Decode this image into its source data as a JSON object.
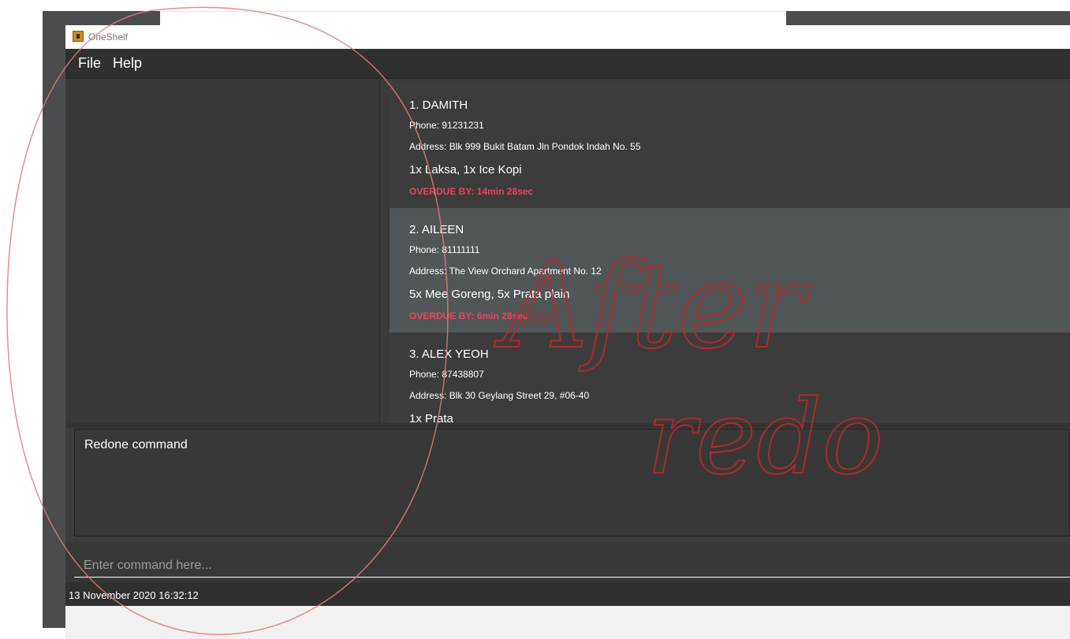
{
  "window": {
    "title": "OneShelf"
  },
  "menu": {
    "file": "File",
    "help": "Help"
  },
  "orders": [
    {
      "name": "1.  DAMITH",
      "phone": "Phone: 91231231",
      "address": "Address: Blk 999 Bukit Batam Jln Pondok Indah No. 55",
      "items": "1x Laksa, 1x Ice Kopi",
      "status": "OVERDUE BY: 14min 28sec"
    },
    {
      "name": "2.  AILEEN",
      "phone": "Phone: 81111111",
      "address": "Address: The View Orchard Apartment No. 12",
      "items": "5x Mee Goreng, 5x Prata plain",
      "status": "OVERDUE BY: 6min 28sec"
    },
    {
      "name": "3.  ALEX YEOH",
      "phone": "Phone: 87438807",
      "address": "Address: Blk 30 Geylang Street 29, #06-40",
      "items": "1x Prata"
    }
  ],
  "result": {
    "message": "Redone command"
  },
  "command": {
    "placeholder": "Enter command here..."
  },
  "status": {
    "datetime": "13 November 2020 16:32:12"
  },
  "annotation": {
    "line1": "After",
    "line2": "redo",
    "color": "#c0272d"
  },
  "colors": {
    "overdue": "#e8435f",
    "selected_card": "#515658",
    "background": "#3d3d3d"
  }
}
